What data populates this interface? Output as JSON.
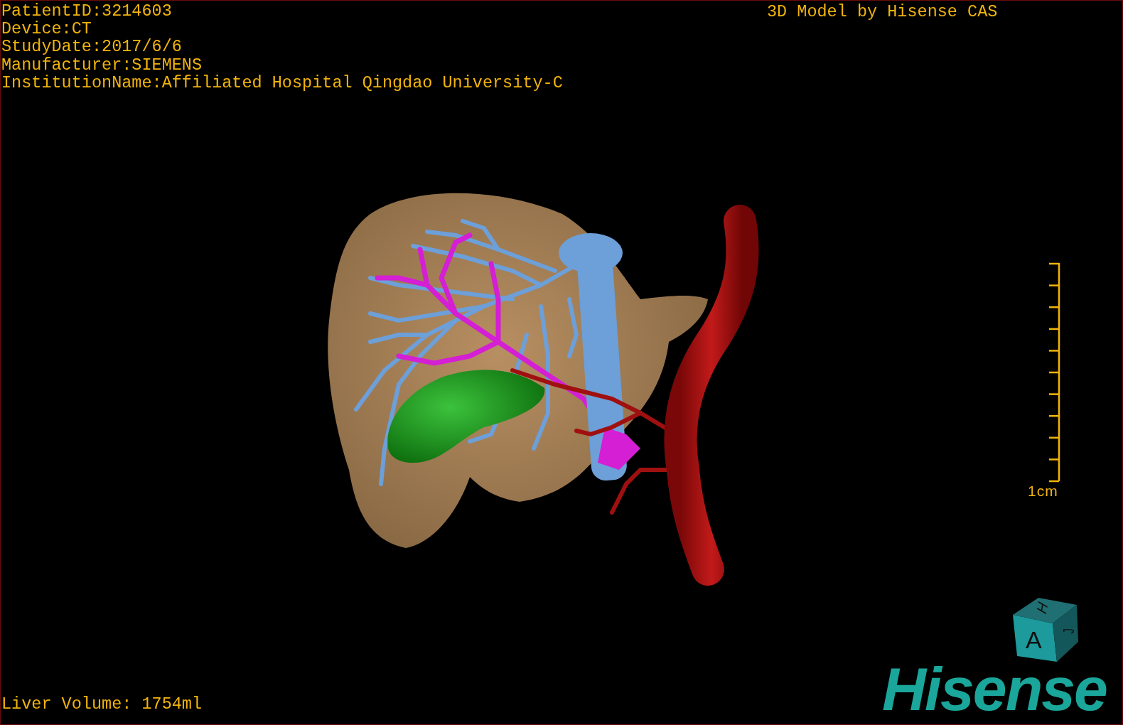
{
  "info_lines": [
    "PatientID:3214603",
    "Device:CT",
    "StudyDate:2017/6/6",
    "Manufacturer:SIEMENS",
    "InstitutionName:Affiliated Hospital Qingdao University-C"
  ],
  "title": "3D Model by Hisense CAS",
  "scale_bar": {
    "label": "1cm"
  },
  "orientation_cube": {
    "faces": [
      {
        "kind": "top",
        "letter": "H"
      },
      {
        "kind": "front",
        "letter": "A"
      },
      {
        "kind": "side",
        "letter": "J"
      }
    ]
  },
  "measurement": "Liver Volume: 1754ml",
  "logo": "Hisense"
}
